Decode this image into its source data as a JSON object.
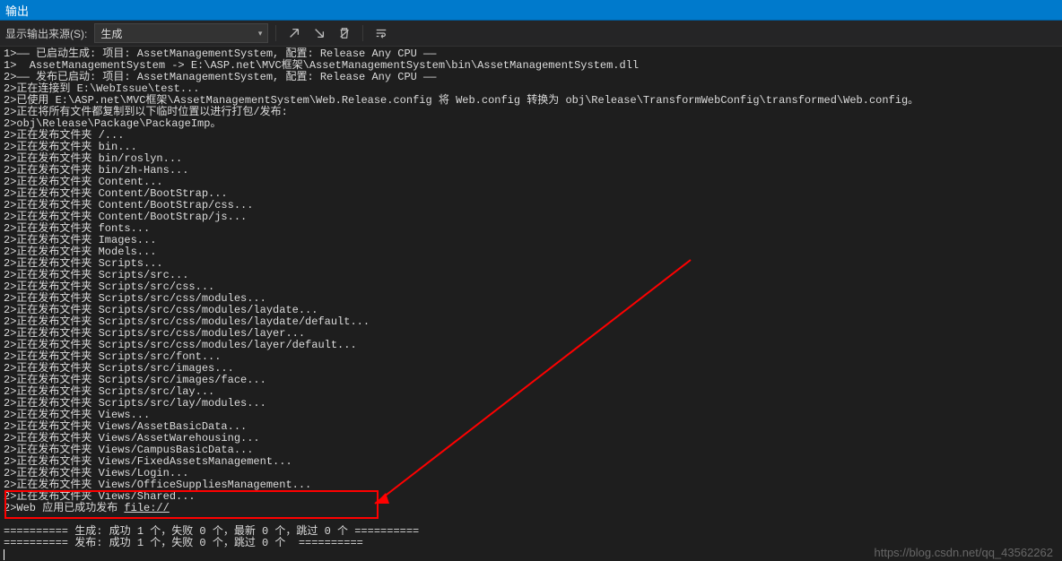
{
  "window": {
    "title": "输出"
  },
  "toolbar": {
    "source_label": "显示输出来源(S):",
    "source_value": "生成"
  },
  "output": {
    "lines": [
      "1>—— 已启动生成: 项目: AssetManagementSystem, 配置: Release Any CPU ——",
      "1>  AssetManagementSystem -> E:\\ASP.net\\MVC框架\\AssetManagementSystem\\bin\\AssetManagementSystem.dll",
      "2>—— 发布已启动: 项目: AssetManagementSystem, 配置: Release Any CPU ——",
      "2>正在连接到 E:\\WebIssue\\test...",
      "2>已使用 E:\\ASP.net\\MVC框架\\AssetManagementSystem\\Web.Release.config 将 Web.config 转换为 obj\\Release\\TransformWebConfig\\transformed\\Web.config。",
      "2>正在将所有文件都复制到以下临时位置以进行打包/发布:",
      "2>obj\\Release\\Package\\PackageImp。",
      "2>正在发布文件夹 /...",
      "2>正在发布文件夹 bin...",
      "2>正在发布文件夹 bin/roslyn...",
      "2>正在发布文件夹 bin/zh-Hans...",
      "2>正在发布文件夹 Content...",
      "2>正在发布文件夹 Content/BootStrap...",
      "2>正在发布文件夹 Content/BootStrap/css...",
      "2>正在发布文件夹 Content/BootStrap/js...",
      "2>正在发布文件夹 fonts...",
      "2>正在发布文件夹 Images...",
      "2>正在发布文件夹 Models...",
      "2>正在发布文件夹 Scripts...",
      "2>正在发布文件夹 Scripts/src...",
      "2>正在发布文件夹 Scripts/src/css...",
      "2>正在发布文件夹 Scripts/src/css/modules...",
      "2>正在发布文件夹 Scripts/src/css/modules/laydate...",
      "2>正在发布文件夹 Scripts/src/css/modules/laydate/default...",
      "2>正在发布文件夹 Scripts/src/css/modules/layer...",
      "2>正在发布文件夹 Scripts/src/css/modules/layer/default...",
      "2>正在发布文件夹 Scripts/src/font...",
      "2>正在发布文件夹 Scripts/src/images...",
      "2>正在发布文件夹 Scripts/src/images/face...",
      "2>正在发布文件夹 Scripts/src/lay...",
      "2>正在发布文件夹 Scripts/src/lay/modules...",
      "2>正在发布文件夹 Views...",
      "2>正在发布文件夹 Views/AssetBasicData...",
      "2>正在发布文件夹 Views/AssetWarehousing...",
      "2>正在发布文件夹 Views/CampusBasicData...",
      "2>正在发布文件夹 Views/FixedAssetsManagement...",
      "2>正在发布文件夹 Views/Login...",
      "2>正在发布文件夹 Views/OfficeSuppliesManagement..."
    ],
    "highlight_top": "2>正在发布文件夹 Views/Shared...",
    "highlight_prefix": "2>Web 应用已成功发布 ",
    "highlight_link": "file://",
    "summary1": "========== 生成: 成功 1 个，失败 0 个，最新 0 个，跳过 0 个 ==========",
    "summary2": "========== 发布: 成功 1 个，失败 0 个，跳过 0 个  =========="
  },
  "watermark": "https://blog.csdn.net/qq_43562262"
}
